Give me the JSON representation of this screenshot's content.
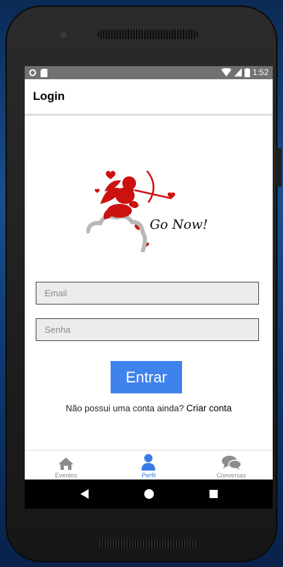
{
  "status_bar": {
    "time": "1:52"
  },
  "app_bar": {
    "title": "Login"
  },
  "logo": {
    "text": "Go Now!"
  },
  "form": {
    "email_placeholder": "Email",
    "password_placeholder": "Senha",
    "submit_label": "Entrar"
  },
  "signup": {
    "prompt": "Não possui uma conta ainda?",
    "link": "Criar conta"
  },
  "bottom_nav": {
    "items": [
      {
        "label": "Eventos",
        "icon": "home-icon",
        "active": false
      },
      {
        "label": "Perfil",
        "icon": "person-icon",
        "active": true
      },
      {
        "label": "Conversas",
        "icon": "chat-icon",
        "active": false
      }
    ]
  },
  "colors": {
    "accent": "#3f82ec",
    "status_bar": "#717171",
    "logo_red": "#cc1111"
  }
}
